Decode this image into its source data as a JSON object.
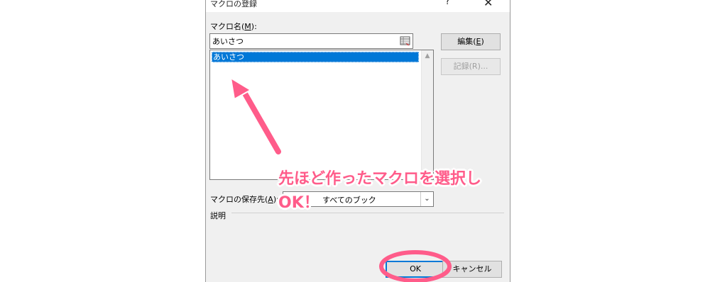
{
  "dialog": {
    "title": "マクロの登録",
    "help_glyph": "?",
    "close_glyph": "✕",
    "macro_name_label_prefix": "マクロ名(",
    "macro_name_label_key": "M",
    "macro_name_label_suffix": "):",
    "macro_name_value": "あいさつ",
    "macro_list": [
      "あいさつ"
    ],
    "edit_button_prefix": "編集(",
    "edit_button_key": "E",
    "edit_button_suffix": ")",
    "record_button": "記録(R)...",
    "save_location_label_prefix": "マクロの保存先(",
    "save_location_label_key": "A",
    "save_location_label_suffix": "):",
    "save_location_value": "すべてのブック",
    "description_label": "説明",
    "ok_button": "OK",
    "cancel_button": "キャンセル"
  },
  "annotation": {
    "line1": "先ほど作ったマクロを選択し",
    "line2": "OK！",
    "color": "#ff5c8a"
  },
  "colors": {
    "selection": "#0078d7",
    "dialog_bg": "#f0f0f0"
  }
}
